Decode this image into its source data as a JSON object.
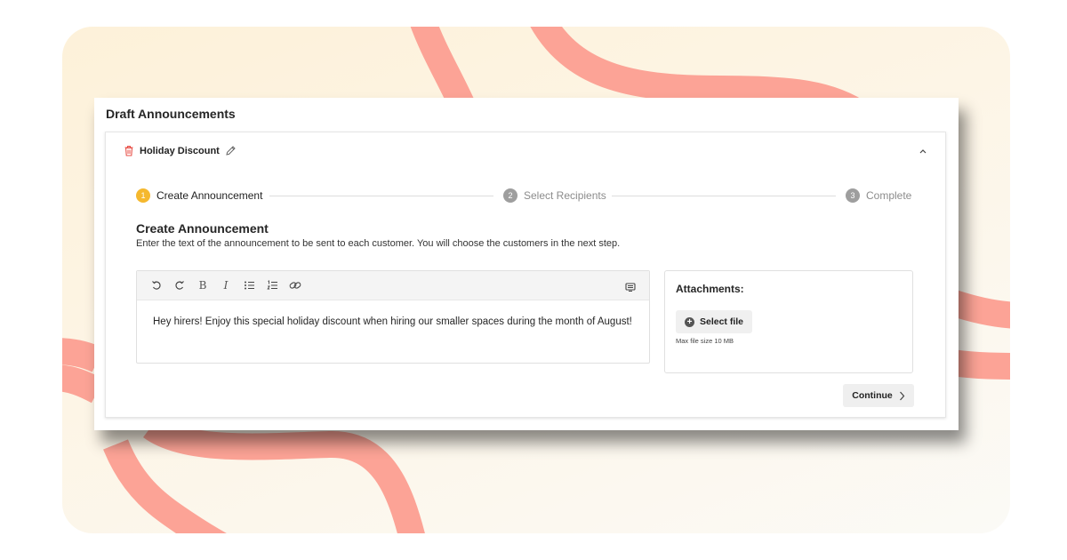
{
  "colors": {
    "panel_bg": "#fdf3e0",
    "ribbon": "#fca396",
    "active_step": "#f5b82e",
    "inactive_step": "#9e9e9e",
    "delete_icon": "#e8524a"
  },
  "page": {
    "title": "Draft Announcements"
  },
  "announcement": {
    "name": "Holiday Discount",
    "icons": {
      "delete": "trash-icon",
      "rename": "pencil-icon",
      "collapse": "chevron-up-icon"
    }
  },
  "stepper": {
    "steps": [
      {
        "number": "1",
        "label": "Create Announcement",
        "state": "active"
      },
      {
        "number": "2",
        "label": "Select Recipients",
        "state": "inactive"
      },
      {
        "number": "3",
        "label": "Complete",
        "state": "inactive"
      }
    ]
  },
  "section": {
    "title": "Create Announcement",
    "description": "Enter the text of the announcement to be sent to each customer. You will choose the customers in the next step."
  },
  "editor": {
    "toolbar": [
      "undo-icon",
      "redo-icon",
      "bold-icon",
      "italic-icon",
      "bullet-list-icon",
      "numbered-list-icon",
      "link-icon",
      "preview-icon"
    ],
    "toolbar_glyphs": {
      "bold": "B",
      "italic": "I"
    },
    "content": "Hey hirers! Enjoy this special holiday discount when hiring our smaller spaces during the month of August!"
  },
  "attachments": {
    "title": "Attachments:",
    "button_label": "Select file",
    "note": "Max file size 10 MB"
  },
  "actions": {
    "continue_label": "Continue"
  }
}
